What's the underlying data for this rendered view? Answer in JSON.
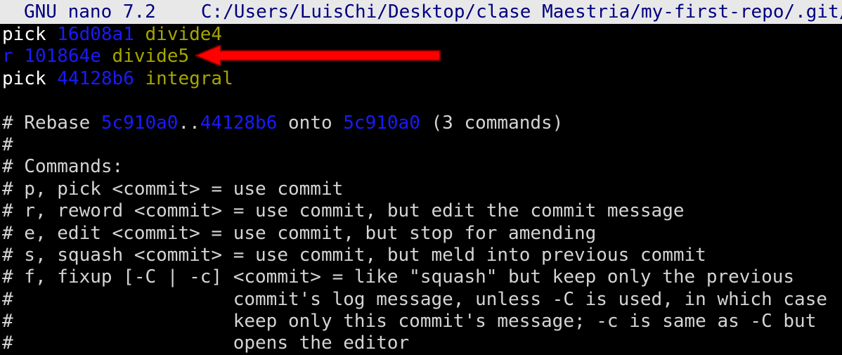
{
  "titlebar": {
    "app": "GNU nano 7.2",
    "file": "C:/Users/LuisChi/Desktop/clase Maestria/my-first-repo/.git/"
  },
  "todo": [
    {
      "cmd": "pick",
      "hash": "16d08a1",
      "msg": "divide4"
    },
    {
      "cmd": "r",
      "hash": "101864e",
      "msg": "divide5"
    },
    {
      "cmd": "pick",
      "hash": "44128b6",
      "msg": "integral"
    }
  ],
  "rebase_line": {
    "prefix": "# Rebase ",
    "from": "5c910a0",
    "dots": "..",
    "to": "44128b6",
    "onto_word": " onto ",
    "onto": "5c910a0",
    "suffix": " (3 commands)"
  },
  "comments": [
    "#",
    "# Commands:",
    "# p, pick <commit> = use commit",
    "# r, reword <commit> = use commit, but edit the commit message",
    "# e, edit <commit> = use commit, but stop for amending",
    "# s, squash <commit> = use commit, but meld into previous commit",
    "# f, fixup [-C | -c] <commit> = like \"squash\" but keep only the previous",
    "#                    commit's log message, unless -C is used, in which case",
    "#                    keep only this commit's message; -c is same as -C but",
    "#                    opens the editor"
  ],
  "colors": {
    "background": "#000000",
    "titlebar_bg": "#e8e8e8",
    "titlebar_text": "#000080",
    "hash": "#1a1aff",
    "message": "#a6a600",
    "arrow": "#ff0000"
  },
  "annotation": {
    "icon": "red-arrow-left-icon"
  }
}
